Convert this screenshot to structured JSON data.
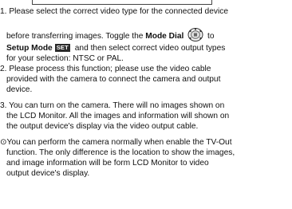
{
  "steps": [
    {
      "id": "step1",
      "line1": "1. Please select the correct video type for the connected device",
      "line2_a": "before transferring images. Toggle the ",
      "line2_bold": "Mode Dial",
      "line2_b": " to",
      "line3_bold": "Setup Mode",
      "line3_badge": "SET",
      "line3_b": " and then select correct video output types",
      "line4": "for your selection: NTSC or PAL."
    },
    {
      "id": "step2",
      "lines": [
        "2. Please process this function; please use the video cable",
        "provided with the camera to connect the camera and output",
        "device."
      ]
    },
    {
      "id": "step3",
      "lines": [
        "3. You can turn on the camera. There will no images shown on",
        "the LCD Monitor. All the images and information will shown on",
        "the output device's display via the video output cable."
      ]
    },
    {
      "id": "note",
      "lines": [
        "⊙You can perform the camera normally when enable the TV-Out",
        "function. The only difference is the location to show the images,",
        "and image information will be form LCD Monitor to video",
        "output device's display."
      ]
    }
  ],
  "icons": {
    "mode_dial": "mode-dial-icon",
    "setup_badge": "setup-mode-badge"
  }
}
